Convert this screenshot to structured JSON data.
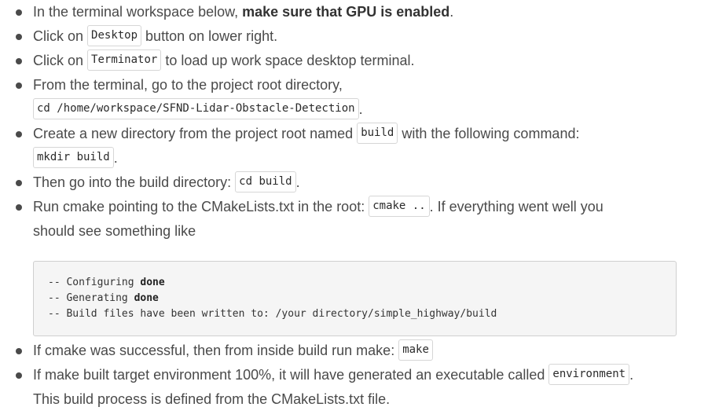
{
  "steps": [
    {
      "pre": "In the terminal workspace below, ",
      "bold": "make sure that GPU is enabled",
      "post": "."
    },
    {
      "pre": "Click on ",
      "code": "Desktop",
      "post": " button on lower right."
    },
    {
      "pre": "Click on ",
      "code": "Terminator",
      "post": " to load up work space desktop terminal."
    },
    {
      "line1": "From the terminal, go to the project root directory,",
      "code": "cd /home/workspace/SFND-Lidar-Obstacle-Detection",
      "post": "."
    },
    {
      "pre": "Create a new directory from the project root named ",
      "code": "build",
      "post": " with the following command:",
      "code2": "mkdir build",
      "post2": "."
    },
    {
      "pre": "Then go into the build directory: ",
      "code": "cd build",
      "post": "."
    },
    {
      "pre": "Run cmake pointing to the CMakeLists.txt in the root: ",
      "code": "cmake ..",
      "post": ". If everything went well you",
      "line2": "should see something like"
    }
  ],
  "output_block": [
    {
      "prefix": "-- Configuring ",
      "bold": "done"
    },
    {
      "prefix": "-- Generating ",
      "bold": "done"
    },
    {
      "prefix": "-- Build files have been written to: /your directory/simple_highway/build",
      "bold": ""
    }
  ],
  "after_steps": [
    {
      "pre": "If cmake was successful, then from inside build run make: ",
      "code": "make",
      "post": ""
    },
    {
      "pre": "If make built target environment 100%, it will have generated an executable called ",
      "code": "environment",
      "post": ".",
      "line2": "This build process is defined from the CMakeLists.txt file."
    }
  ]
}
